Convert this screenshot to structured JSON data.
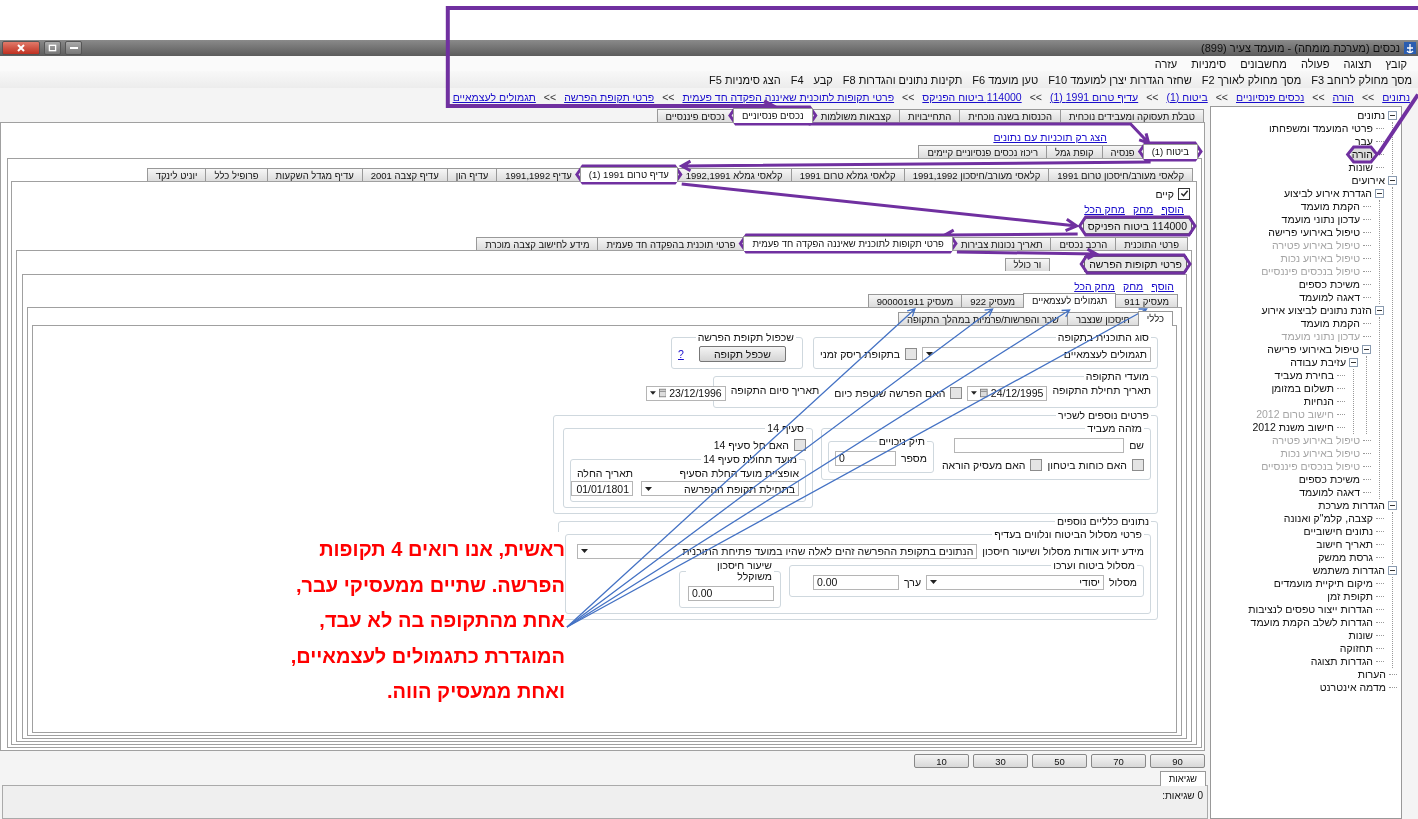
{
  "window": {
    "title": "נכסים (מערכת מומחה) - מועמד צעיר (899)"
  },
  "menu": [
    "קובץ",
    "תצוגה",
    "פעולה",
    "מחשבונים",
    "סימניות",
    "עזרה"
  ],
  "toolbar": [
    "מסך מחולק לרוחב F3",
    "מסך מחולק לאורך F2",
    "שחזר הגדרות יצרן למועמד F10",
    "טען מועמד F6",
    "תקינות נתונים והגדרות F8",
    "קבע",
    "F4",
    "הצג סימניות F5"
  ],
  "breadcrumb": {
    "separator": ">>",
    "items": [
      "נתונים",
      "הורה",
      "נכסים פנסיוניים",
      "ביטוח (1)",
      "עדיף טרום 1991 (1)",
      "114000 ביטוח הפניקס",
      "פרטי תקופות לתוכנית שאיננה הפקדה חד פעמית",
      "פרטי תקופת הפרשה",
      "תגמולים לעצמאיים"
    ]
  },
  "main_tabs": [
    {
      "label": "טבלת תעסוקה ומעבידים נוכחית",
      "selected": false
    },
    {
      "label": "הכנסות בשנה נוכחית",
      "selected": false
    },
    {
      "label": "התחייבויות",
      "selected": false
    },
    {
      "label": "קצבאות משולמות",
      "selected": false
    },
    {
      "label": "נכסים פנסיוניים",
      "selected": true
    },
    {
      "label": "נכסים פיננסיים",
      "selected": false
    }
  ],
  "filter_link": "הצג רק תוכניות עם נתונים",
  "asset_tabs": [
    {
      "label": "ביטוח (1)",
      "selected": true
    },
    {
      "label": "פנסיה",
      "selected": false
    },
    {
      "label": "קופת גמל",
      "selected": false
    },
    {
      "label": "ריכוז נכסים פנסיוניים קיימים",
      "selected": false
    }
  ],
  "policy_tabs": [
    {
      "label": "קלאסי מעורב/חיסכון טרום 1991",
      "selected": false
    },
    {
      "label": "קלאסי מעורב/חיסכון 1991,1992",
      "selected": false
    },
    {
      "label": "קלאסי גמלא טרום 1991",
      "selected": false
    },
    {
      "label": "קלאסי גמלא 1992,1991",
      "selected": false
    },
    {
      "label": "עדיף טרום 1991 (1)",
      "selected": true
    },
    {
      "label": "עדיף 1991,1992",
      "selected": false
    },
    {
      "label": "עדיף הון",
      "selected": false
    },
    {
      "label": "עדיף קצבה 2001",
      "selected": false
    },
    {
      "label": "עדיף מגדל השקעות",
      "selected": false
    },
    {
      "label": "פרופיל כלל",
      "selected": false
    },
    {
      "label": "יוניט לינקד",
      "selected": false
    }
  ],
  "exists": {
    "label": "קיים",
    "checked": true
  },
  "plan_links": [
    "הוסף",
    "מחק",
    "מחק הכל"
  ],
  "plans": [
    {
      "label": "114000 ביטוח הפניקס",
      "selected": true
    }
  ],
  "plan_tabs": [
    {
      "label": "פרטי התוכנית",
      "selected": false
    },
    {
      "label": "הרכב נכסים",
      "selected": false
    },
    {
      "label": "תאריך נכונות צבירות",
      "selected": false
    },
    {
      "label": "פרטי תקופות לתוכנית שאיננה הפקדה חד פעמית",
      "selected": true
    },
    {
      "label": "פרטי תוכנית בהפקדה חד פעמית",
      "selected": false
    },
    {
      "label": "מידע לחישוב קצבה מוכרת",
      "selected": false
    }
  ],
  "periods": [
    {
      "label": "פרטי תקופות הפרשה",
      "selected": true
    }
  ],
  "summary_tabs": [
    {
      "label": "ור כולל",
      "selected": false
    }
  ],
  "period_links": [
    "הוסף",
    "מחק",
    "מחק הכל"
  ],
  "employer_tabs": [
    {
      "label": "מעסיק 911",
      "selected": false
    },
    {
      "label": "תגמולים לעצמאיים",
      "selected": true
    },
    {
      "label": "מעסיק 922",
      "selected": false
    },
    {
      "label": "מעסיק 900001911",
      "selected": false
    }
  ],
  "detail_tabs": [
    {
      "label": "כללי",
      "selected": true
    },
    {
      "label": "חיסכון שנצבר",
      "selected": false
    },
    {
      "label": "שכר והפרשות/פרמיות במהלך התקופה",
      "selected": false
    }
  ],
  "form": {
    "plan_type": {
      "legend": "סוג התוכנית בתקופה",
      "value": "תגמולים לעצמאיים",
      "risk_label": "בתקופת ריסק זמני",
      "risk_checked": false
    },
    "duplicate": {
      "legend": "שכפול תקופת הפרשה",
      "button": "שכפל תקופה",
      "help": "?"
    },
    "dates": {
      "legend": "מועדי התקופה",
      "start_label": "תאריך תחילת התקופה",
      "start": "24/12/1995",
      "ongoing_label": "האם הפרשה שוטפת כיום",
      "ongoing_checked": false,
      "end_label": "תאריך סיום התקופה",
      "end": "23/12/1996"
    },
    "employee": {
      "legend": "פרטים נוספים לשכיר",
      "employer": {
        "legend": "מזהה מעביד",
        "name_label": "שם",
        "security_label": "האם כוחות ביטחון",
        "security_checked": false,
        "teaching_label": "האם מעסיק הוראה",
        "teaching_checked": false
      },
      "deductions": {
        "legend": "תיק ניכויים",
        "number_label": "מספר",
        "number": "0"
      },
      "section14": {
        "legend": "סעיף 14",
        "applies_label": "האם חל סעיף 14",
        "applies_checked": false,
        "start_legend": "מועד תחולת סעיף 14",
        "option_label": "אופציית מועד החלת הסעיף",
        "option": "בתחילת תקופת ההפרשה",
        "date_label": "תאריך החלה",
        "date": "01/01/1801"
      }
    },
    "general": {
      "legend": "נתונים כלליים נוספים",
      "insurance_legend": "פרטי מסלול הביטוח ונלווים בעדיף",
      "info_label": "מידע ידוע אודות מסלול ושיעור חיסכון",
      "info": "הנתונים בתקופת ההפרשה זהים לאלה שהיו במועד פתיחת התוכנית",
      "track": {
        "legend": "מסלול ביטוח וערכו",
        "track_label": "מסלול",
        "track": "יסודי",
        "value_label": "ערך",
        "value": "0.00"
      },
      "savings": {
        "legend": "שיעור חיסכון משוקלל",
        "value": "0.00"
      }
    }
  },
  "zoom_buttons": [
    "90",
    "70",
    "50",
    "30",
    "10"
  ],
  "errors": {
    "tab": "שגיאות",
    "text": "0 שגיאות:"
  },
  "annotation": [
    "ראשית, אנו רואים 4 תקופות",
    "הפרשה. שתיים ממעסיקי עבר,",
    "אחת מהתקופה בה לא עבד,",
    "המוגדרת כתגמולים לעצמאיים,",
    "ואחת ממעסיק הווה."
  ],
  "tree": [
    {
      "label": "נתונים",
      "expanded": true,
      "selected": false,
      "disabled": false,
      "children": [
        {
          "label": "פרטי המועמד ומשפחתו",
          "selected": false,
          "disabled": false
        },
        {
          "label": "עבר",
          "selected": false,
          "disabled": false
        },
        {
          "label": "הורה",
          "selected": true,
          "disabled": false
        },
        {
          "label": "שונות",
          "selected": false,
          "disabled": false
        }
      ]
    },
    {
      "label": "אירועים",
      "expanded": true,
      "selected": false,
      "disabled": false,
      "children": [
        {
          "label": "הגדרת אירוע לביצוע",
          "expanded": true,
          "selected": false,
          "disabled": false,
          "children": [
            {
              "label": "הקמת מועמד",
              "selected": false,
              "disabled": false
            },
            {
              "label": "עדכון נתוני מועמד",
              "selected": false,
              "disabled": false
            },
            {
              "label": "טיפול באירועי פרישה",
              "selected": false,
              "disabled": false
            },
            {
              "label": "טיפול באירוע פטירה",
              "selected": false,
              "disabled": true
            },
            {
              "label": "טיפול באירוע נכות",
              "selected": false,
              "disabled": true
            },
            {
              "label": "טיפול בנכסים פיננסיים",
              "selected": false,
              "disabled": true
            },
            {
              "label": "משיכת כספים",
              "selected": false,
              "disabled": false
            },
            {
              "label": "דאגה למועמד",
              "selected": false,
              "disabled": false
            }
          ]
        },
        {
          "label": "הזנת נתונים לביצוע אירוע",
          "expanded": true,
          "selected": false,
          "disabled": false,
          "children": [
            {
              "label": "הקמת מועמד",
              "selected": false,
              "disabled": false
            },
            {
              "label": "עדכון נתוני מועמד",
              "selected": false,
              "disabled": true
            },
            {
              "label": "טיפול באירועי פרישה",
              "expanded": true,
              "selected": false,
              "disabled": false,
              "children": [
                {
                  "label": "עזיבת עבודה",
                  "expanded": true,
                  "selected": false,
                  "disabled": false,
                  "children": [
                    {
                      "label": "בחירת מעביד",
                      "selected": false,
                      "disabled": false
                    },
                    {
                      "label": "תשלום במזומן",
                      "selected": false,
                      "disabled": false
                    },
                    {
                      "label": "הנחיות",
                      "selected": false,
                      "disabled": false
                    },
                    {
                      "label": "חישוב טרום 2012",
                      "selected": false,
                      "disabled": true
                    },
                    {
                      "label": "חישוב משנת 2012",
                      "selected": false,
                      "disabled": false
                    }
                  ]
                }
              ]
            },
            {
              "label": "טיפול באירוע פטירה",
              "selected": false,
              "disabled": true
            },
            {
              "label": "טיפול באירוע נכות",
              "selected": false,
              "disabled": true
            },
            {
              "label": "טיפול בנכסים פיננסיים",
              "selected": false,
              "disabled": true
            },
            {
              "label": "משיכת כספים",
              "selected": false,
              "disabled": false
            },
            {
              "label": "דאגה למועמד",
              "selected": false,
              "disabled": false
            }
          ]
        }
      ]
    },
    {
      "label": "הגדרות מערכת",
      "expanded": true,
      "selected": false,
      "disabled": false,
      "children": [
        {
          "label": "קצבה, קלמ\"ק ואנונה",
          "selected": false,
          "disabled": false
        },
        {
          "label": "נתונים חישוביים",
          "selected": false,
          "disabled": false
        },
        {
          "label": "תאריך חישוב",
          "selected": false,
          "disabled": false
        },
        {
          "label": "גרסת ממשק",
          "selected": false,
          "disabled": false
        }
      ]
    },
    {
      "label": "הגדרות משתמש",
      "expanded": true,
      "selected": false,
      "disabled": false,
      "children": [
        {
          "label": "מיקום תיקיית מועמדים",
          "selected": false,
          "disabled": false
        },
        {
          "label": "תקופת זמן",
          "selected": false,
          "disabled": false
        },
        {
          "label": "הגדרות ייצור טפסים לנציבות",
          "selected": false,
          "disabled": false
        },
        {
          "label": "הגדרות לשלב הקמת מועמד",
          "selected": false,
          "disabled": false
        },
        {
          "label": "שונות",
          "selected": false,
          "disabled": false
        },
        {
          "label": "תחזוקה",
          "selected": false,
          "disabled": false
        },
        {
          "label": "הגדרות תצוגה",
          "selected": false,
          "disabled": false
        }
      ]
    },
    {
      "label": "הערות",
      "selected": false,
      "disabled": false
    },
    {
      "label": "מדמה אינטרנט",
      "selected": false,
      "disabled": false
    }
  ]
}
